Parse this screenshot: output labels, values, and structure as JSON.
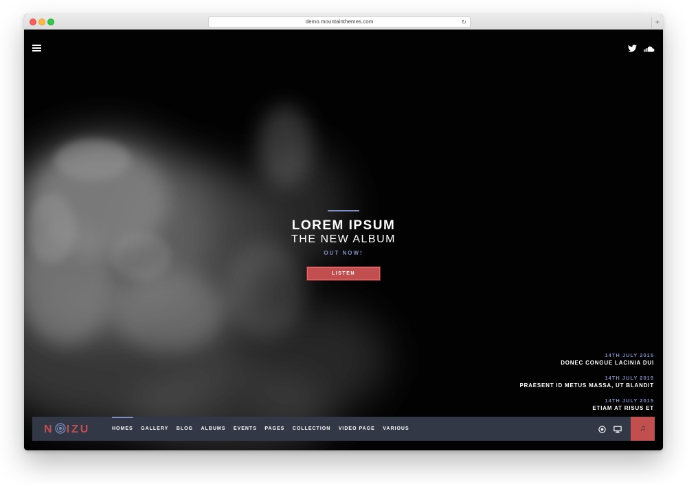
{
  "browser": {
    "url": "demo.mountainthemes.com",
    "newtab_label": "+",
    "reload_glyph": "↻"
  },
  "header": {
    "menu_icon": "hamburger-menu-icon",
    "social": [
      "twitter-icon",
      "soundcloud-icon"
    ]
  },
  "hero": {
    "title": "LOREM IPSUM",
    "subtitle": "THE NEW ALBUM",
    "tagline": "OUT NOW!",
    "button_label": "LISTEN"
  },
  "events": [
    {
      "date": "14TH JULY 2015",
      "title": "DONEC CONGUE LACINIA DUI"
    },
    {
      "date": "14TH JULY 2015",
      "title": "PRAESENT ID METUS MASSA, UT BLANDIT"
    },
    {
      "date": "14TH JULY 2015",
      "title": "ETIAM AT RISUS ET"
    }
  ],
  "nav": {
    "logo_left": "N",
    "logo_right": "IZU",
    "items": [
      "HOMES",
      "GALLERY",
      "BLOG",
      "ALBUMS",
      "EVENTS",
      "PAGES",
      "COLLECTION",
      "VIDEO PAGE",
      "VARIOUS"
    ],
    "active_index": 0,
    "tools": [
      "record-icon",
      "monitor-icon"
    ],
    "music_glyph": "♫"
  },
  "colors": {
    "accent": "#7f8fc1",
    "brand_red": "#c24f4f",
    "navbar": "#333847",
    "background": "#020203"
  }
}
